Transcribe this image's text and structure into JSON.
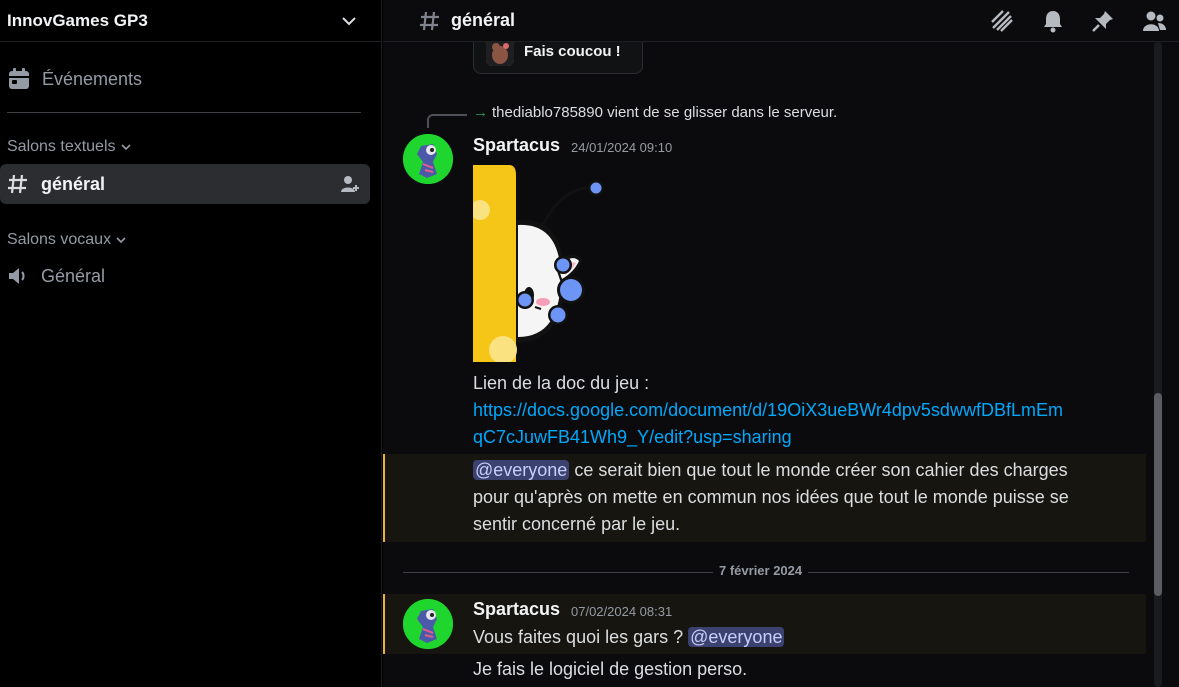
{
  "server": {
    "name": "InnovGames GP3"
  },
  "sidebar": {
    "events_label": "Événements",
    "text_category": "Salons textuels",
    "text_channels": [
      {
        "name": "général",
        "active": true
      }
    ],
    "voice_category": "Salons vocaux",
    "voice_channels": [
      {
        "name": "Général"
      }
    ]
  },
  "channel": {
    "name": "général"
  },
  "top_icons": [
    "threads-icon",
    "bell-icon",
    "pin-icon",
    "members-icon"
  ],
  "welcome_sticker": {
    "label": "Fais coucou !"
  },
  "system_message": {
    "text": "thediablo785890 vient de se glisser dans le serveur."
  },
  "messages": [
    {
      "author": "Spartacus",
      "timestamp": "24/01/2024 09:10",
      "line1": "Lien de la doc du jeu :",
      "link_line1": "https://docs.google.com/document/d/19OiX3ueBWr4dpv5sdwwfDBfLmEm",
      "link_line2": "qC7cJuwFB41Wh9_Y/edit?usp=sharing",
      "mention": "@everyone",
      "mention_rest1": " ce serait bien que tout le monde créer son cahier des charges",
      "mention_rest2": "pour qu'après on mette en commun nos idées que tout le monde puisse se",
      "mention_rest3": "sentir concerné par le jeu."
    },
    {
      "author": "Spartacus",
      "timestamp": "07/02/2024 08:31",
      "text": "Vous faites quoi les gars ? ",
      "mention": "@everyone",
      "next": "Je fais le logiciel de gestion perso."
    }
  ],
  "date_divider": "7 février 2024",
  "colors": {
    "accent_mention_bg": "#3c4270",
    "link": "#00a8fc",
    "highlight_border": "#f0b232"
  }
}
